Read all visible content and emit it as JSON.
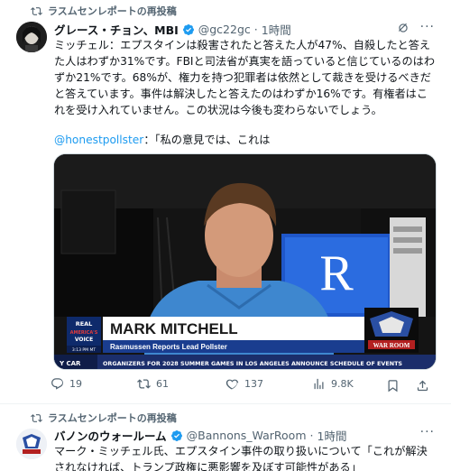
{
  "tweets": [
    {
      "repost_label": "ラスムセンレポートの再投稿",
      "author_name": "グレース・チョン、MBI",
      "author_handle": "@gc22gc",
      "dot": "·",
      "time": "1時間",
      "body_lines": [
        "ミッチェル：エプスタインは殺害されたと答えた人が47%、自殺したと答え",
        "た人はわずか31%です。FBIと司法省が真実を語っていると信じているのはわ",
        "ずか21%です。68%が、権力を持つ犯罪者は依然として裁きを受けるべきだ",
        "と答えています。事件は解決したと答えたのはわずか16%です。有権者はこ",
        "れを受け入れていません。この状況は今後も変わらないでしょう。"
      ],
      "quote_mention": "@honestpollster",
      "quote_rest": "：「私の意見では、これは",
      "video": {
        "lower_third_name": "MARK MITCHELL",
        "lower_third_title": "Rasmussen Reports Lead Pollster",
        "network_logo_line1": "REAL",
        "network_logo_line2": "AMERICA'S",
        "network_logo_line3": "VOICE",
        "clock": "3:13 PM MT",
        "ticker_left": "Y CAR",
        "ticker_text": "ORGANIZERS FOR 2028 SUMMER GAMES IN LOS ANGELES ANNOUNCE SCHEDULE OF EVENTS",
        "show_logo": "WAR ROOM",
        "monitor_letter": "R"
      },
      "actions": {
        "replies": "19",
        "reposts": "61",
        "likes": "137",
        "views": "9.8K"
      }
    },
    {
      "repost_label": "ラスムセンレポートの再投稿",
      "author_name": "バノンのウォールーム",
      "author_handle": "@Bannons_WarRoom",
      "dot": "·",
      "time": "1時間",
      "body_lines": [
        "マーク・ミッチェル氏、エプスタイン事件の取り扱いについて「これが解決",
        "されなければ、トランプ政権に悪影響を及ぼす可能性がある」"
      ]
    }
  ],
  "colors": {
    "accent": "#1d9bf0",
    "muted": "#536471",
    "text": "#0f1419",
    "lower_third_blue": "#1a3d8f"
  }
}
